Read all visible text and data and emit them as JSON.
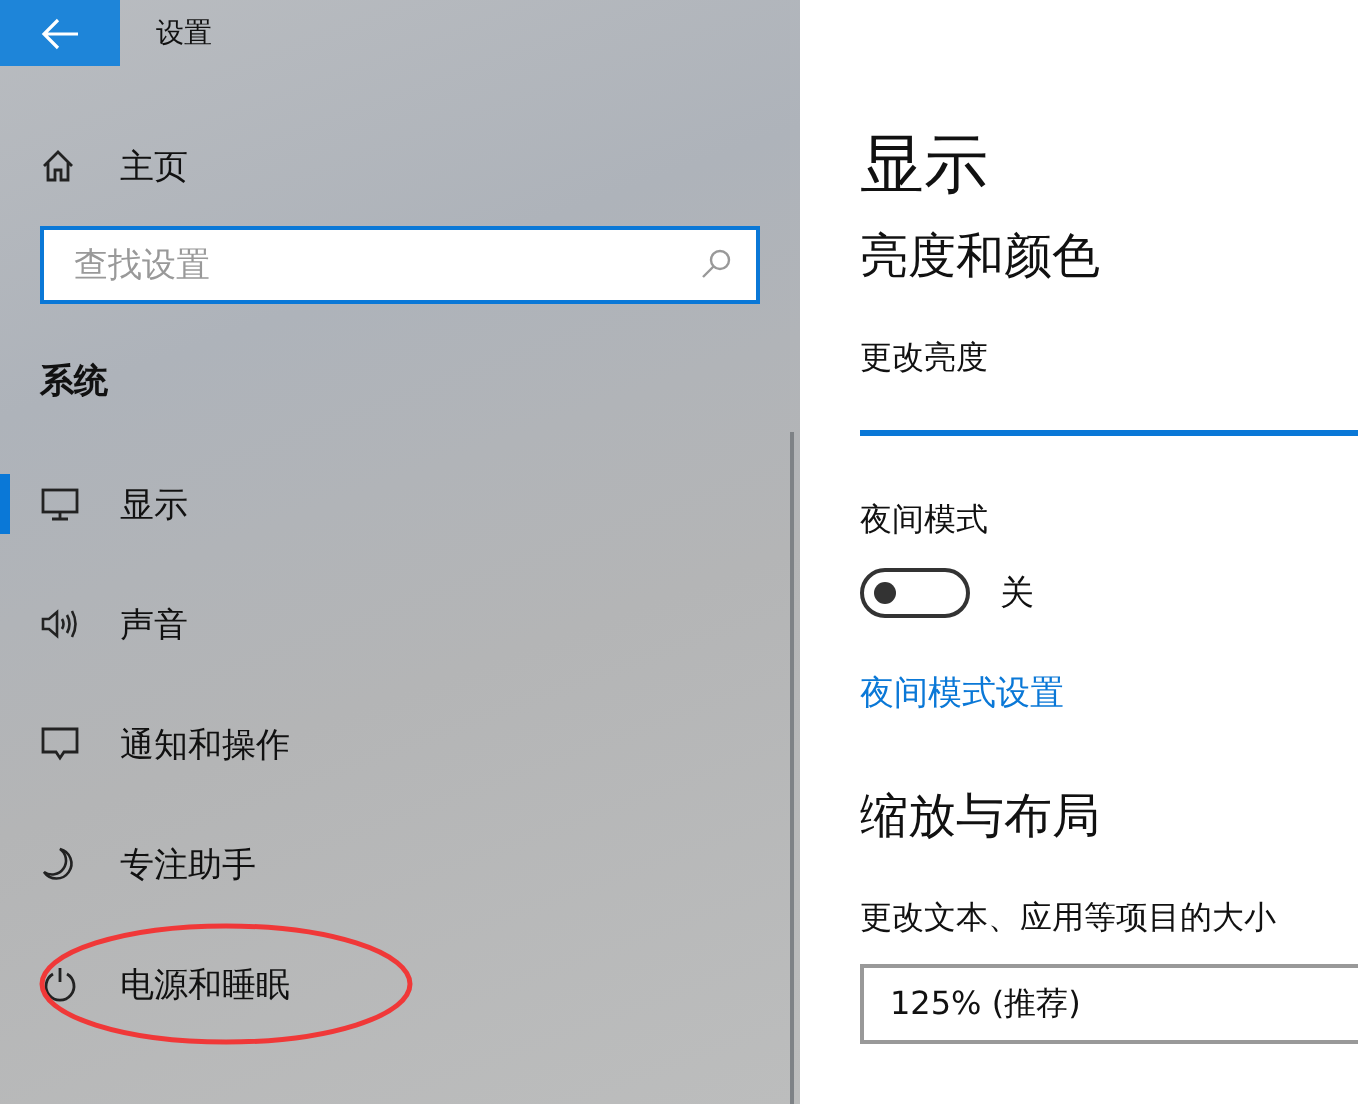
{
  "window": {
    "title": "设置"
  },
  "sidebar": {
    "home": "主页",
    "search": {
      "placeholder": "查找设置"
    },
    "section": "系统",
    "items": [
      {
        "label": "显示",
        "kind": "monitor",
        "selected": true
      },
      {
        "label": "声音",
        "kind": "speaker",
        "selected": false
      },
      {
        "label": "通知和操作",
        "kind": "message",
        "selected": false
      },
      {
        "label": "专注助手",
        "kind": "moon",
        "selected": false
      },
      {
        "label": "电源和睡眠",
        "kind": "power",
        "selected": false,
        "circled": true
      }
    ]
  },
  "content": {
    "title": "显示",
    "sections": [
      {
        "kind": "brightness",
        "heading": "亮度和颜色",
        "label": "更改亮度"
      },
      {
        "kind": "night",
        "label": "夜间模式",
        "toggle": {
          "on": false,
          "text": "关"
        },
        "link": "夜间模式设置"
      },
      {
        "kind": "scale",
        "heading": "缩放与布局",
        "label": "更改文本、应用等项目的大小",
        "value": "125% (推荐)"
      }
    ]
  }
}
